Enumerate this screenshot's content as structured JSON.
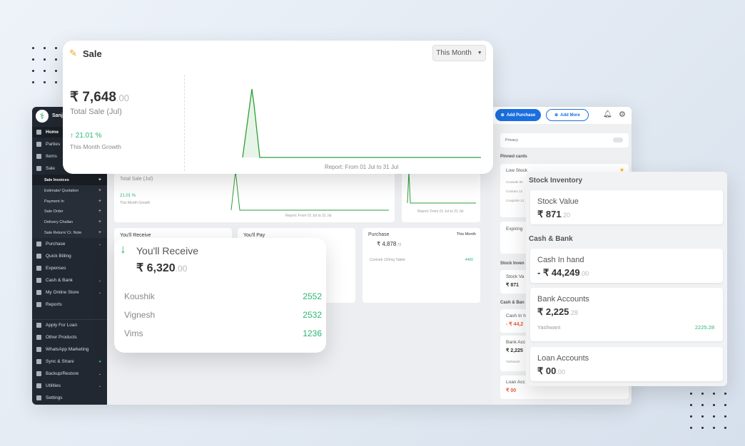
{
  "sidebar": {
    "brand": "Sanja",
    "items": [
      {
        "label": "Home",
        "icon": "home-icon"
      },
      {
        "label": "Parties",
        "icon": "users-icon"
      },
      {
        "label": "Items",
        "icon": "items-icon"
      },
      {
        "label": "Sale",
        "icon": "sale-icon"
      },
      {
        "label": "Sale Invoices",
        "sub": true
      },
      {
        "label": "Estimate/ Quotation",
        "sub": true
      },
      {
        "label": "Payment In",
        "sub": true
      },
      {
        "label": "Sale Order",
        "sub": true
      },
      {
        "label": "Delivery Challan",
        "sub": true
      },
      {
        "label": "Sale Return/ Cr. Note",
        "sub": true
      },
      {
        "label": "Purchase",
        "icon": "cart-icon",
        "chev": true
      },
      {
        "label": "Quick Billing",
        "icon": "billing-icon"
      },
      {
        "label": "Expenses",
        "icon": "wallet-icon"
      },
      {
        "label": "Cash & Bank",
        "icon": "bank-icon",
        "chev": true
      },
      {
        "label": "My Online Store",
        "icon": "store-icon",
        "chev": true
      },
      {
        "label": "Reports",
        "icon": "chart-icon"
      },
      {
        "label": "Apply For Loan",
        "icon": "bag-icon"
      },
      {
        "label": "Other Products",
        "icon": "products-icon"
      },
      {
        "label": "WhatsApp Marketing",
        "icon": "whatsapp-icon"
      },
      {
        "label": "Sync & Share",
        "icon": "sync-icon"
      },
      {
        "label": "Backup/Restore",
        "icon": "backup-icon",
        "chev": true
      },
      {
        "label": "Utilities",
        "icon": "wrench-icon",
        "chev": true
      },
      {
        "label": "Settings",
        "icon": "gear-icon"
      }
    ]
  },
  "sale": {
    "title": "Sale",
    "period": "This Month",
    "amount": "₹ 7,648",
    "amount_dec": ".00",
    "subtitle": "Total Sale (Jul)",
    "growth": "21.01 %",
    "growth_label": "This Month Growth",
    "report": "Report: From 01 Jul to 31 Jul"
  },
  "bg": {
    "total_sale": "Total Sale (Jul)",
    "growth": "21.01 %",
    "growth_label": "This Month Growth",
    "report": "Report: From 01 Jul to 31 Jul",
    "receive": "You'll Receive",
    "pay": "You'll Pay",
    "purchase": "Purchase",
    "purchase_period": "This Month",
    "purchase_amount": "₹ 4,878",
    "purchase_dec": ".72",
    "purchase_item": "Coxineb 120mg Tablet",
    "purchase_item_val": "4400"
  },
  "receive": {
    "title": "You'll Receive",
    "amount": "₹ 6,320",
    "amount_dec": ".00",
    "rows": [
      {
        "name": "Koushik",
        "value": "2552"
      },
      {
        "name": "Vignesh",
        "value": "2532"
      },
      {
        "name": "Vims",
        "value": "1236"
      }
    ]
  },
  "header": {
    "add_purchase": "Add Purchase",
    "add_more": "Add More"
  },
  "rightpanel": {
    "privacy": "Privacy",
    "pinned": "Pinned cards",
    "low_stock": "Low Stock",
    "low_items": [
      "Coxisafe 90",
      "Coxiraro 12",
      "Coxipride 12"
    ],
    "expiring": "Expiring",
    "stock_inv": "Stock Inven",
    "stock_val": "Stock Va",
    "stock_amt": "₹ 871",
    "cash_bank": "Cash & Ban",
    "cash": "Cash In h",
    "cash_amt": "- ₹ 44,2",
    "bank": "Bank Acc",
    "bank_amt": "₹ 2,225",
    "bank_name": "Yashwant",
    "loan": "Loan Acc",
    "loan_amt": "₹ 00"
  },
  "stock": {
    "section1": "Stock Inventory",
    "stock_value_label": "Stock Value",
    "stock_value": "₹ 871",
    "stock_value_dec": ".20",
    "section2": "Cash & Bank",
    "cash_label": "Cash In hand",
    "cash_value": "- ₹ 44,249",
    "cash_dec": ".00",
    "bank_label": "Bank Accounts",
    "bank_value": "₹ 2,225",
    "bank_dec": ".28",
    "bank_name": "Yashwant",
    "bank_name_value": "2225.28",
    "loan_label": "Loan Accounts",
    "loan_value": "₹ 00",
    "loan_dec": ".00"
  },
  "colors": {
    "accent": "#1a73e8",
    "green": "#2bb673",
    "red": "#f0583c",
    "sidebar": "#222831"
  }
}
